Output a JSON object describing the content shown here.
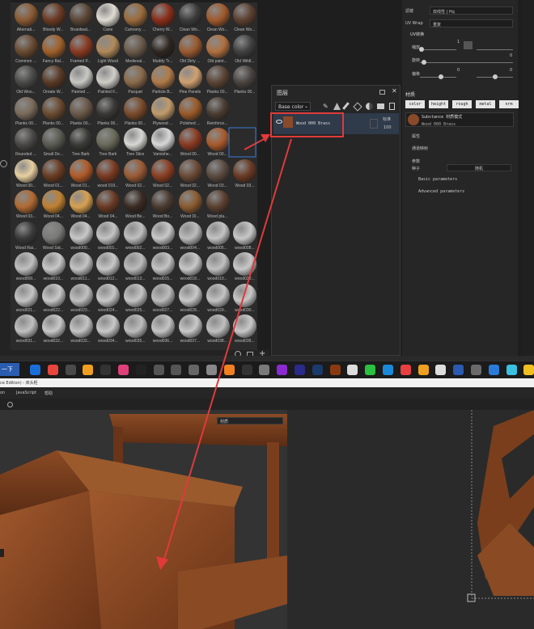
{
  "materials": [
    {
      "label": "Alternati...",
      "c": "#8a5a32"
    },
    {
      "label": "Bloody W...",
      "c": "#6b3a22"
    },
    {
      "label": "Boardwal...",
      "c": "#5a4636"
    },
    {
      "label": "Cane",
      "c": "#e0dcd4"
    },
    {
      "label": "Cartoony ...",
      "c": "#9a6a3c"
    },
    {
      "label": "Cherry W...",
      "c": "#8a2e1a"
    },
    {
      "label": "Clean Wo...",
      "c": "#3c3c3c"
    },
    {
      "label": "Clean Wo...",
      "c": "#a05a2c"
    },
    {
      "label": "Clean Wo...",
      "c": "#5c4030"
    },
    {
      "label": "Common ...",
      "c": "#6a4a30"
    },
    {
      "label": "Fancy Bal...",
      "c": "#a0602a"
    },
    {
      "label": "Framed P...",
      "c": "#8a3a22"
    },
    {
      "label": "Light Wood",
      "c": "#b08a5a"
    },
    {
      "label": "Medieval...",
      "c": "#6a5a4a"
    },
    {
      "label": "Muddy Tr...",
      "c": "#2e2620"
    },
    {
      "label": "Old Dirty ...",
      "c": "#9a5a30"
    },
    {
      "label": "Old paint...",
      "c": "#b07040"
    },
    {
      "label": "Old Wildl...",
      "c": "#404040"
    },
    {
      "label": "Old Woo...",
      "c": "#4a4a48"
    },
    {
      "label": "Ornate W...",
      "c": "#5a3a26"
    },
    {
      "label": "Painted ...",
      "c": "#c8c8c4"
    },
    {
      "label": "Painted F...",
      "c": "#d0cec8"
    },
    {
      "label": "Parquet",
      "c": "#8a6a4a"
    },
    {
      "label": "Particle B...",
      "c": "#b07a48"
    },
    {
      "label": "Pine Panels",
      "c": "#d0a070"
    },
    {
      "label": "Planks 00...",
      "c": "#5a4434"
    },
    {
      "label": "Planks 00...",
      "c": "#4a4440"
    },
    {
      "label": "Planks 00...",
      "c": "#7a6a5a"
    },
    {
      "label": "Planks 00...",
      "c": "#6a4a30"
    },
    {
      "label": "Planks 00...",
      "c": "#6a5848"
    },
    {
      "label": "Planks 00...",
      "c": "#3a3836"
    },
    {
      "label": "Planks 00...",
      "c": "#7a4a2a"
    },
    {
      "label": "Plywood ...",
      "c": "#c09a6a"
    },
    {
      "label": "Polished ...",
      "c": "#9a5a28"
    },
    {
      "label": "Reinforce...",
      "c": "#4a3c32"
    },
    {
      "label": "",
      "c": "#2b2b2b"
    },
    {
      "label": "Rounded ...",
      "c": "#4a4846"
    },
    {
      "label": "Small De...",
      "c": "#5a5a52"
    },
    {
      "label": "Tree Bark",
      "c": "#3a3a36"
    },
    {
      "label": "Tree Bark",
      "c": "#6a6a5a"
    },
    {
      "label": "Tree Slice",
      "c": "#d8d8d4"
    },
    {
      "label": "Varnishe...",
      "c": "#d8d8d8"
    },
    {
      "label": "Wood 00...",
      "c": "#8a3a22"
    },
    {
      "label": "Wood 00...",
      "c": "#a85a2c"
    },
    {
      "label": "",
      "c": "#2b2b2b"
    },
    {
      "label": "Wood 00...",
      "c": "#e8d0a0"
    },
    {
      "label": "Wood 01...",
      "c": "#6a3c22"
    },
    {
      "label": "Wood 01...",
      "c": "#b05a28"
    },
    {
      "label": "wood 019...",
      "c": "#7a3a22"
    },
    {
      "label": "Wood 02...",
      "c": "#9a5a34"
    },
    {
      "label": "Wood 02...",
      "c": "#8a3e22"
    },
    {
      "label": "Wood 02...",
      "c": "#6a4a36"
    },
    {
      "label": "Wood 03...",
      "c": "#5a4a40"
    },
    {
      "label": "Wood 03...",
      "c": "#6a3a24"
    },
    {
      "label": "Wood 03...",
      "c": "#b06a32"
    },
    {
      "label": "Wood 04...",
      "c": "#c08030"
    },
    {
      "label": "Wood 04...",
      "c": "#d8a050"
    },
    {
      "label": "Wood 04...",
      "c": "#6a3a24"
    },
    {
      "label": "Wood Be...",
      "c": "#3a2a22"
    },
    {
      "label": "Wood Bo...",
      "c": "#4a3a30"
    },
    {
      "label": "Wood Di...",
      "c": "#8a5a30"
    },
    {
      "label": "Wood pla...",
      "c": "#5a4030"
    },
    {
      "label": "",
      "c": "#2b2b2b"
    },
    {
      "label": "Wood Rai...",
      "c": "#3a3a3a"
    },
    {
      "label": "Wood Sid...",
      "c": "#7a7a78"
    },
    {
      "label": "wood000...",
      "c": "#c8c8c8"
    },
    {
      "label": "wood001...",
      "c": "#c4c4c4"
    },
    {
      "label": "wood002...",
      "c": "#c0c0c0"
    },
    {
      "label": "wood003...",
      "c": "#c8c8c8"
    },
    {
      "label": "wood004...",
      "c": "#bcbcbc"
    },
    {
      "label": "wood005...",
      "c": "#c4c4c4"
    },
    {
      "label": "wood008...",
      "c": "#c8c8c8"
    },
    {
      "label": "wood009...",
      "c": "#c0c0c0"
    },
    {
      "label": "wood010...",
      "c": "#c8c8c8"
    },
    {
      "label": "wood011...",
      "c": "#c4c4c4"
    },
    {
      "label": "wood012...",
      "c": "#c8c8c8"
    },
    {
      "label": "wood013...",
      "c": "#bcbcbc"
    },
    {
      "label": "wood015...",
      "c": "#c4c4c4"
    },
    {
      "label": "wood018...",
      "c": "#c8c8c8"
    },
    {
      "label": "wood019...",
      "c": "#c0c0c0"
    },
    {
      "label": "wood020...",
      "c": "#c8c8c8"
    },
    {
      "label": "wood021...",
      "c": "#c4c4c4"
    },
    {
      "label": "wood022...",
      "c": "#c8c8c8"
    },
    {
      "label": "wood023...",
      "c": "#c0c0c0"
    },
    {
      "label": "wood024...",
      "c": "#c8c8c8"
    },
    {
      "label": "wood025...",
      "c": "#c4c4c4"
    },
    {
      "label": "wood027...",
      "c": "#bcbcbc"
    },
    {
      "label": "wood028...",
      "c": "#c8c8c8"
    },
    {
      "label": "wood029...",
      "c": "#c4c4c4"
    },
    {
      "label": "wood030...",
      "c": "#c8c8c8"
    },
    {
      "label": "wood031...",
      "c": "#c0c0c0"
    },
    {
      "label": "wood032...",
      "c": "#c8c8c8"
    },
    {
      "label": "wood033...",
      "c": "#c4c4c4"
    },
    {
      "label": "wood034...",
      "c": "#c8c8c8"
    },
    {
      "label": "wood035...",
      "c": "#bcbcbc"
    },
    {
      "label": "wood036...",
      "c": "#c4c4c4"
    },
    {
      "label": "wood037...",
      "c": "#c8c8c8"
    },
    {
      "label": "wood038...",
      "c": "#c0c0c0"
    },
    {
      "label": "wood039...",
      "c": "#c8c8c8"
    }
  ],
  "layers": {
    "title": "图层",
    "channel": "Base color",
    "layer_name": "Wood 000 Brass",
    "blend": "标准",
    "opacity": "100"
  },
  "props": {
    "filter_label": "滤镜",
    "filter_value": "双线性 | Hq",
    "uvwrap_label": "UV Wrap",
    "uvwrap_value": "重复",
    "uv_section": "UV转换",
    "scale_label": "缩放",
    "scale_val": "1",
    "rot_label": "旋转",
    "rot_val": "0",
    "offset_label": "偏移",
    "offset_val1": "0",
    "offset_val2": "0",
    "material_title": "材质",
    "channels": [
      "color",
      "height",
      "rough",
      "metal",
      "nrm"
    ],
    "mat_mode": "Substance 材质模式",
    "mat_name": "Wood 000 Brass",
    "attr": "属性",
    "tech": "通道映射",
    "params": "参数",
    "seed_label": "种子",
    "seed_value": "随机",
    "basic": "Basic parameters",
    "advanced": "Advanced parameters"
  },
  "taskbar": {
    "start": "一下"
  },
  "editor": {
    "title_frag": "ce Edition) - 床头柜",
    "menu": [
      "on",
      "JavaScript",
      "帮助"
    ],
    "viewport_dropdown": "材质"
  }
}
